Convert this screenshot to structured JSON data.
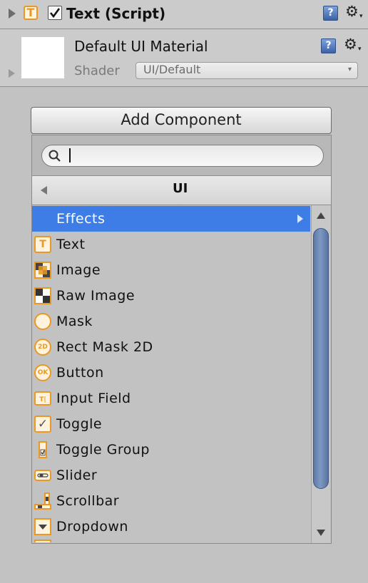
{
  "component": {
    "title": "Text (Script)"
  },
  "material": {
    "name": "Default UI Material",
    "shader_label": "Shader",
    "shader_value": "UI/Default"
  },
  "add_component": {
    "label": "Add Component"
  },
  "search": {
    "value": "",
    "placeholder": ""
  },
  "breadcrumb": {
    "title": "UI"
  },
  "items": [
    {
      "label": "Effects",
      "icon": "none",
      "selected": true
    },
    {
      "label": "Text",
      "icon": "text-icon"
    },
    {
      "label": "Image",
      "icon": "image-icon"
    },
    {
      "label": "Raw Image",
      "icon": "raw-image-icon"
    },
    {
      "label": "Mask",
      "icon": "mask-icon"
    },
    {
      "label": "Rect Mask 2D",
      "icon": "rect-mask-2d-icon",
      "glyph": "2D"
    },
    {
      "label": "Button",
      "icon": "button-icon",
      "glyph": "OK"
    },
    {
      "label": "Input Field",
      "icon": "input-field-icon",
      "glyph": "T|"
    },
    {
      "label": "Toggle",
      "icon": "toggle-icon",
      "glyph": "✓"
    },
    {
      "label": "Toggle Group",
      "icon": "toggle-group-icon"
    },
    {
      "label": "Slider",
      "icon": "slider-icon"
    },
    {
      "label": "Scrollbar",
      "icon": "scrollbar-icon"
    },
    {
      "label": "Dropdown",
      "icon": "dropdown-icon"
    }
  ],
  "icons": {
    "help": "?",
    "gear": "⚙",
    "gear_caret": "▾",
    "text_icon": "T"
  },
  "colors": {
    "selection": "#3e7de6",
    "icon_orange": "#e99823",
    "scroll_thumb": "#6b86b3"
  }
}
